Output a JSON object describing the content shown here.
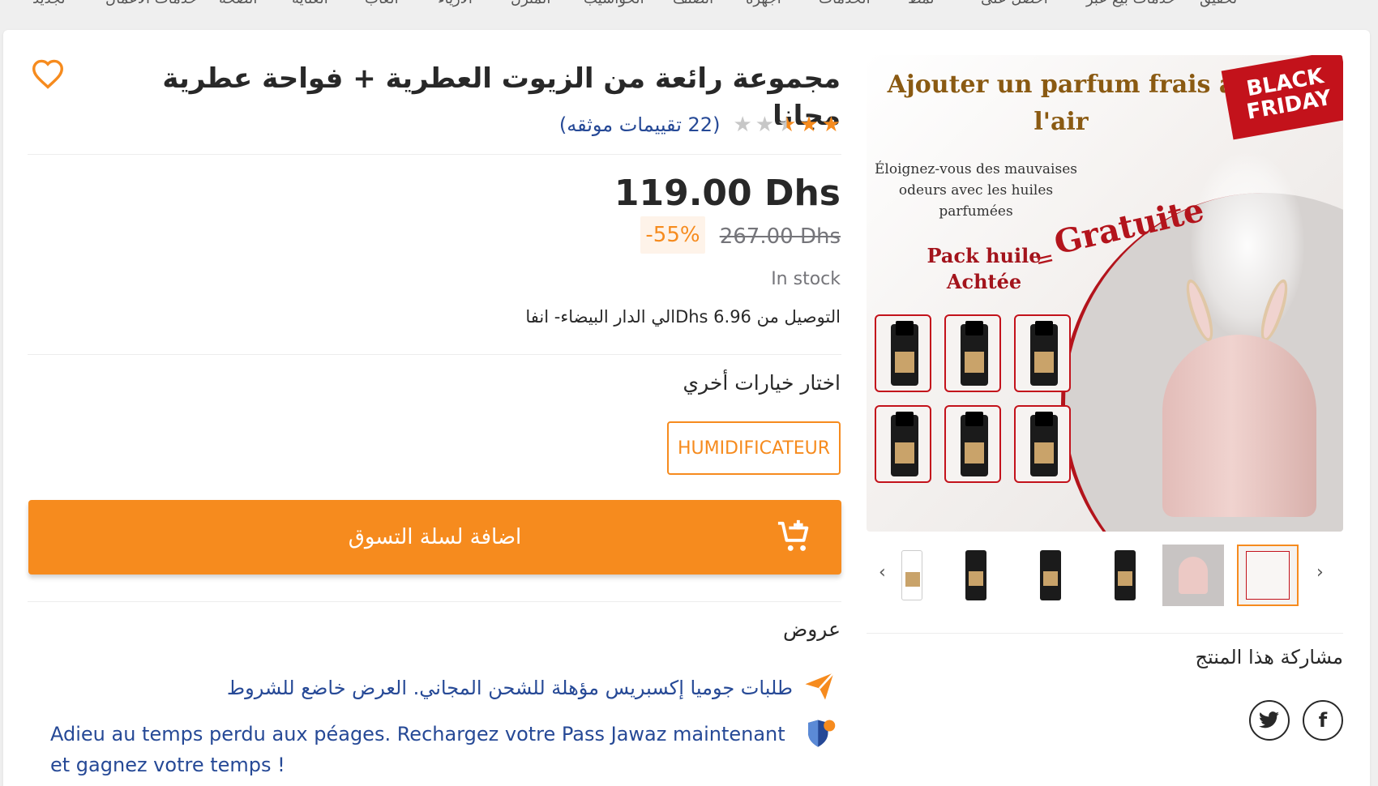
{
  "top_bar": {
    "items": [
      "تحقيق",
      "خدمات بيع عبر",
      "احصل على",
      "نمط",
      "الخدمات",
      "أجهزة",
      "الصنف",
      "الحواسيب",
      "المنزل",
      "الأزياء",
      "ألعاب",
      "العناية",
      "الصحة",
      "خدمات الأعمال",
      "تجديد"
    ]
  },
  "product": {
    "title": "مجموعة رائعة من الزيوت العطرية + فواحة عطرية مجانا",
    "rating": {
      "value": 2.5,
      "max": 5,
      "text": "(22 تقييمات موثقه)"
    },
    "price": "119.00 Dhs",
    "old_price": "267.00 Dhs",
    "discount": "-55%",
    "stock": "In stock",
    "delivery": "التوصيل من Dhs 6.96الي الدار البيضاء- انفا",
    "options_title": "اختار خيارات أخري",
    "option_label": "HUMIDIFICATEUR",
    "add_to_cart": "اضافة لسلة التسوق"
  },
  "offers": {
    "title": "عروض",
    "items": [
      {
        "text": "طلبات جوميا إكسبريس مؤهلة للشحن المجاني. العرض خاضع للشروط",
        "icon": "paper-plane-icon"
      },
      {
        "text": "Adieu au temps perdu aux péages. Rechargez votre Pass Jawaz maintenant et gagnez votre temps !",
        "icon": "shield-badge-icon"
      }
    ]
  },
  "gallery": {
    "main_image": {
      "headline": "Ajouter un parfum frais à l'air",
      "badge": "BLACK FRIDAY",
      "subtext": "Éloignez-vous des mauvaises odeurs avec les huiles parfumées",
      "pack_text": "Pack huile Achtée",
      "equals": "=",
      "free_text": "Gratuite"
    },
    "share_title": "مشاركة هذا المنتج",
    "social": {
      "facebook": "f",
      "twitter": "t"
    }
  },
  "colors": {
    "accent": "#f68b1e",
    "link": "#264996",
    "text": "#282828",
    "muted": "#75757a"
  }
}
